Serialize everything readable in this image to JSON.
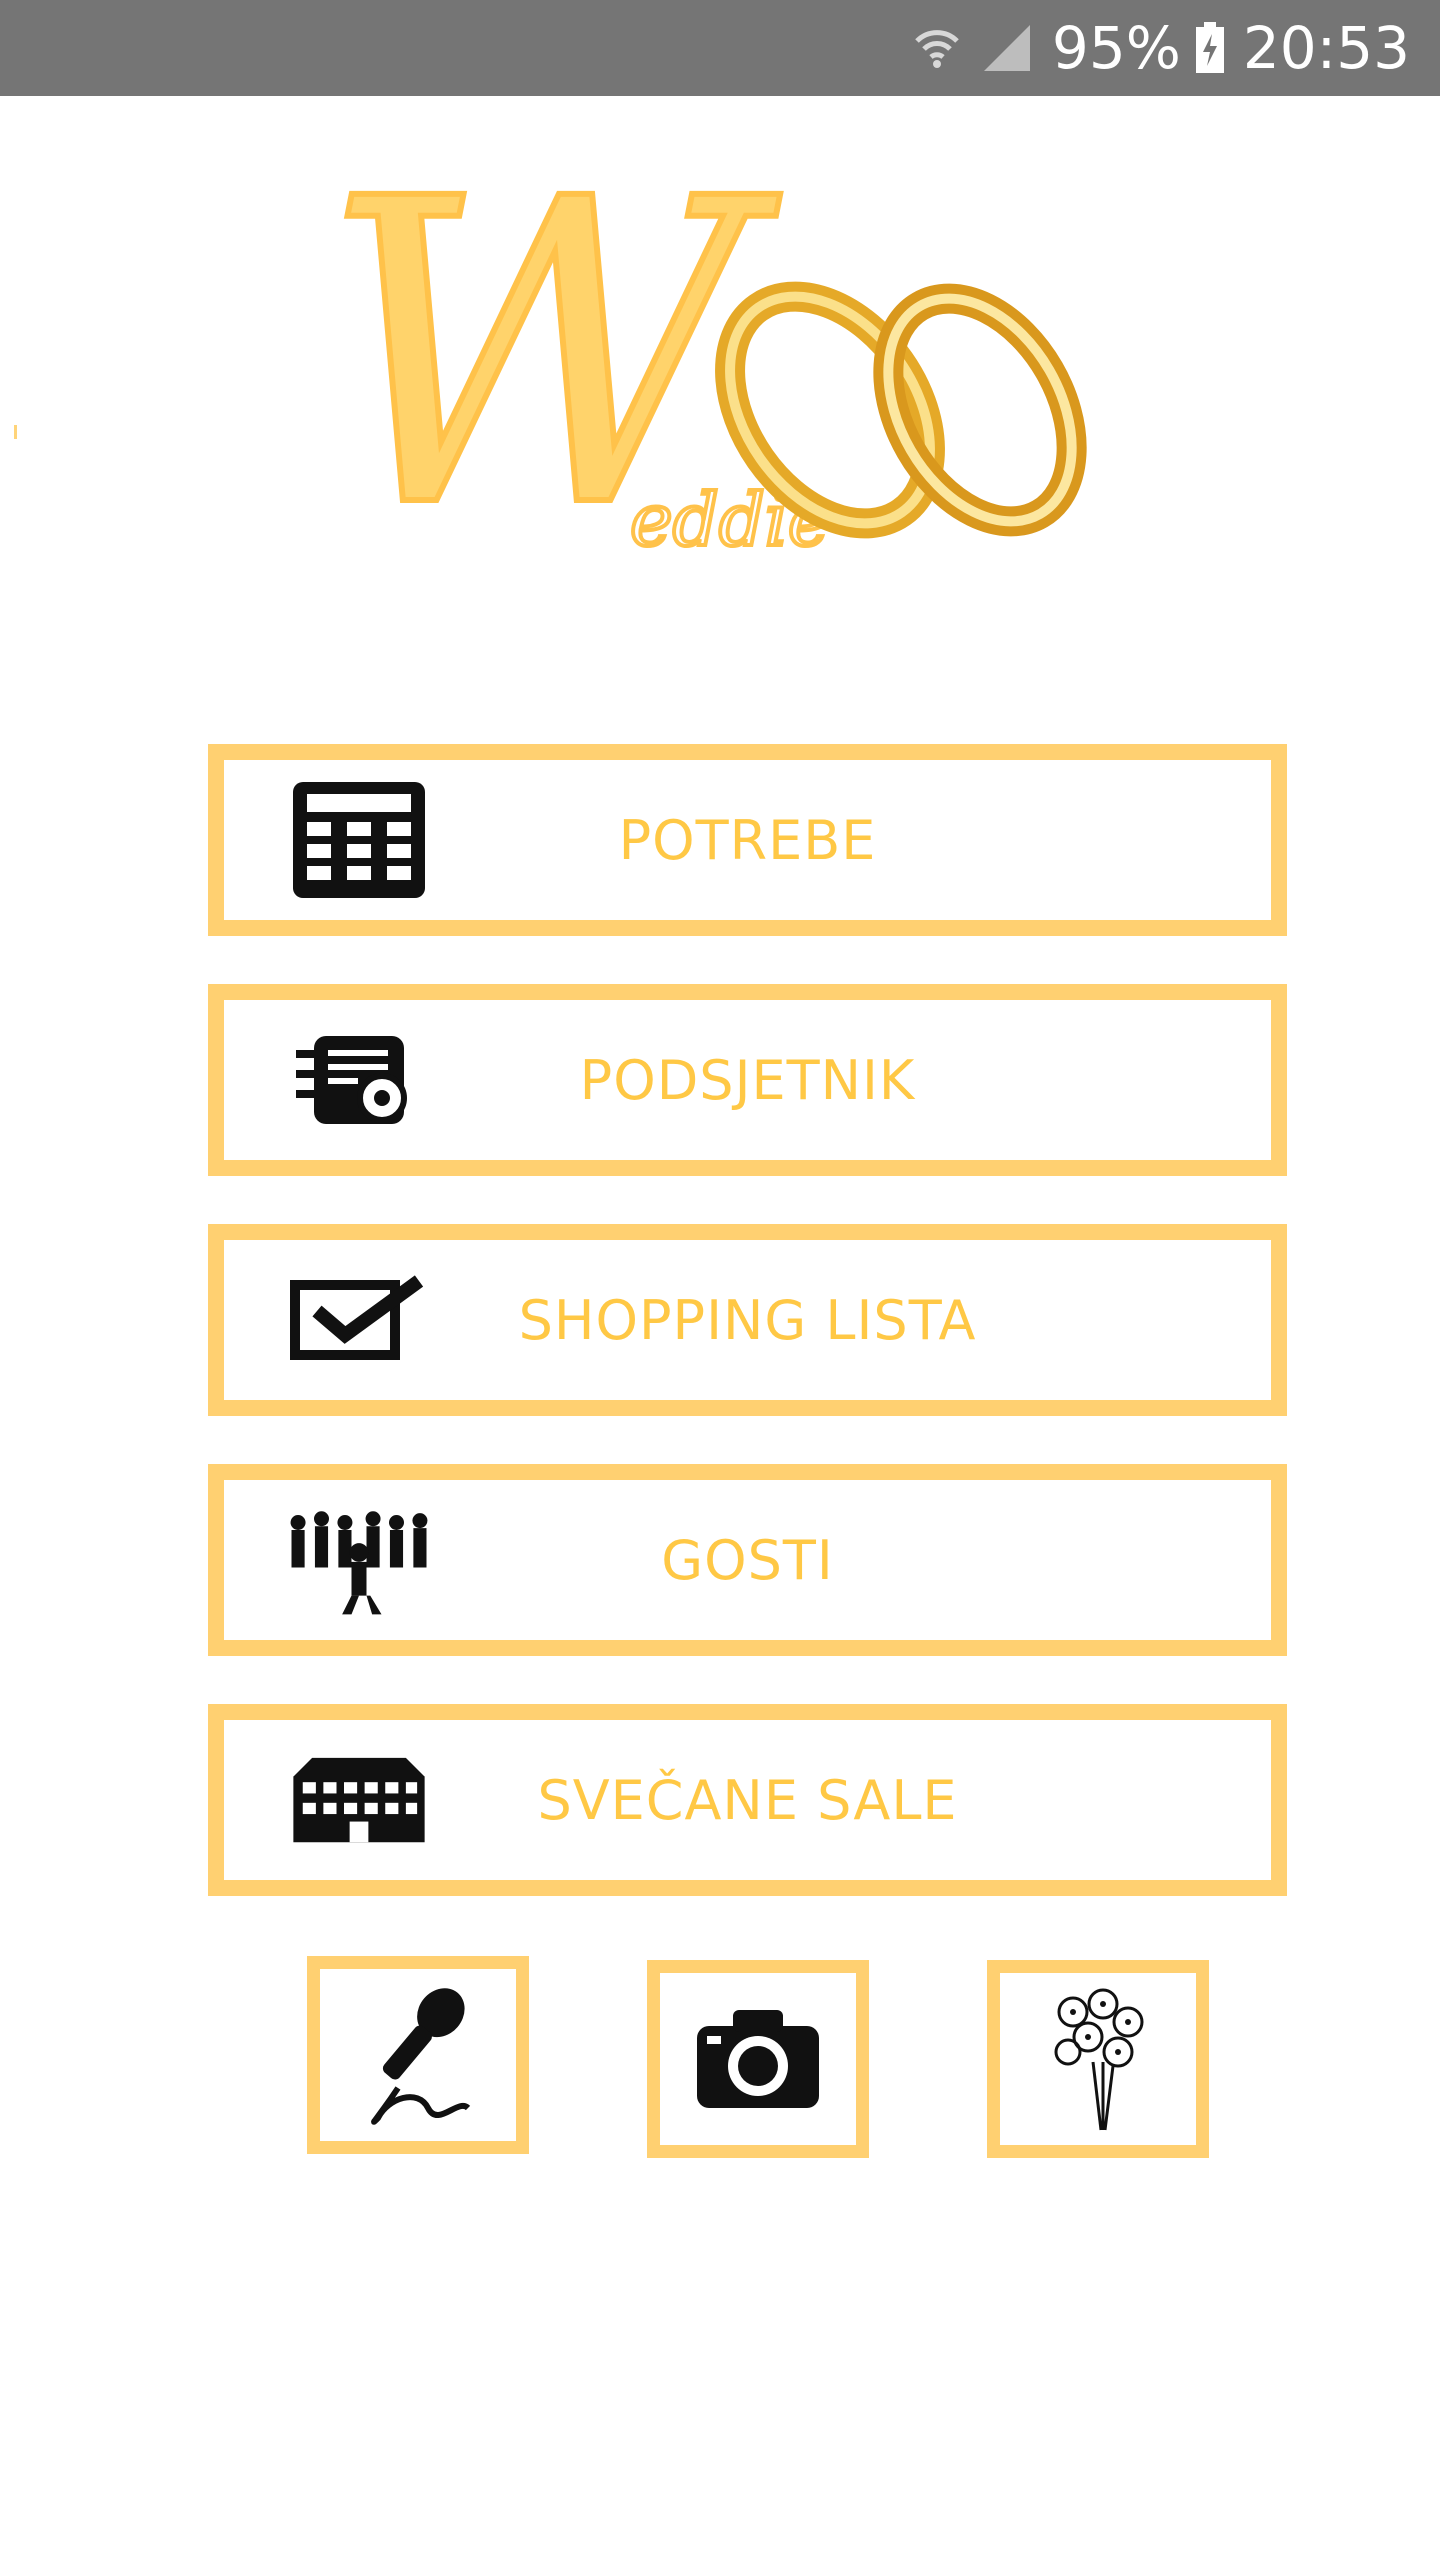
{
  "status_bar": {
    "battery": "95%",
    "time": "20:53",
    "icons": [
      "wifi-icon",
      "signal-icon",
      "battery-charging-icon"
    ]
  },
  "logo": {
    "text": "eddie",
    "letter": "W",
    "icon": "wedding-rings-icon"
  },
  "colors": {
    "accent": "#FFD071",
    "label": "#FFC845",
    "status_bar": "#757575"
  },
  "menu": [
    {
      "label": "POTREBE",
      "icon": "calculator-icon"
    },
    {
      "label": "PODSJETNIK",
      "icon": "reminder-icon"
    },
    {
      "label": "SHOPPING LISTA",
      "icon": "checkbox-icon"
    },
    {
      "label": "GOSTI",
      "icon": "guests-crowd-icon"
    },
    {
      "label": "SVEČANE SALE",
      "icon": "building-icon"
    }
  ],
  "bottom_buttons": [
    {
      "icon": "microphone-icon"
    },
    {
      "icon": "camera-icon"
    },
    {
      "icon": "flower-bouquet-icon"
    }
  ]
}
